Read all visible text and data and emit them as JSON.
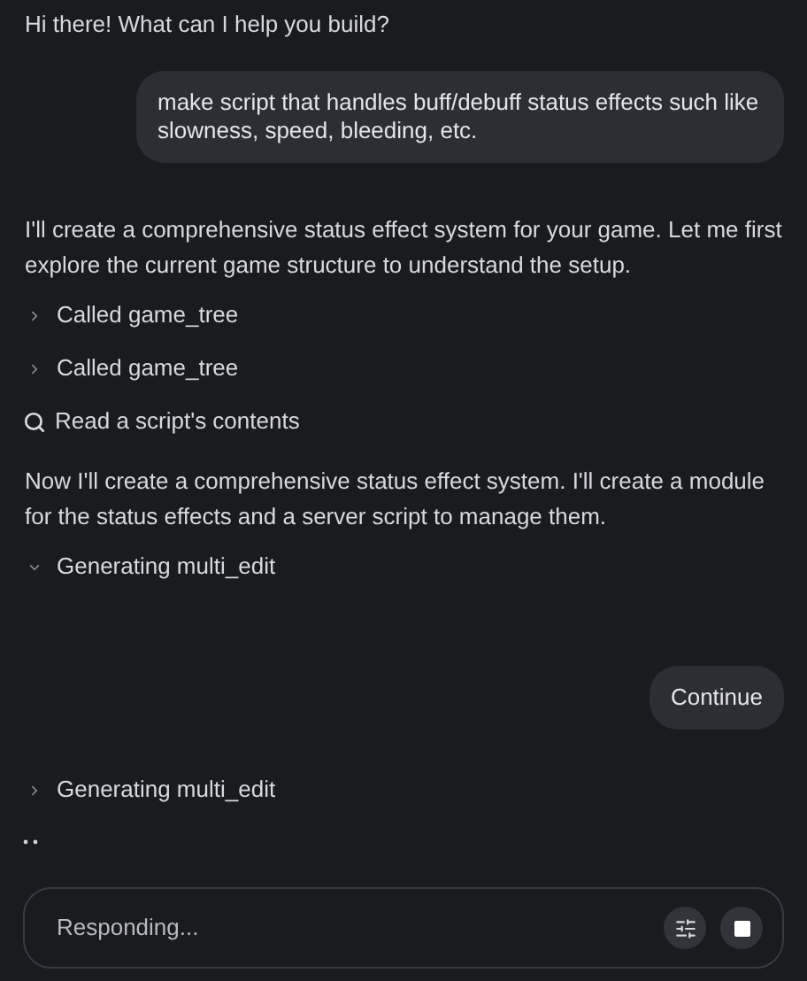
{
  "messages": [
    {
      "kind": "assistant",
      "text": "Hi there! What can I help you build?"
    },
    {
      "kind": "user",
      "text": "make script that handles buff/debuff status effects such like slowness, speed, bleeding, etc."
    },
    {
      "kind": "assistant",
      "text": "I'll create a comprehensive status effect system for your game. Let me first explore the current game structure to understand the setup."
    },
    {
      "kind": "tool",
      "text": "Called game_tree",
      "expanded": false
    },
    {
      "kind": "tool",
      "text": "Called game_tree",
      "expanded": false
    },
    {
      "kind": "search",
      "text": "Read a script's contents"
    },
    {
      "kind": "assistant",
      "text": "Now I'll create a comprehensive status effect system. I'll create a module for the status effects and a server script to manage them."
    },
    {
      "kind": "tool",
      "text": "Generating multi_edit",
      "expanded": true
    },
    {
      "kind": "user",
      "text": "Continue"
    },
    {
      "kind": "tool",
      "text": "Generating multi_edit",
      "expanded": false
    },
    {
      "kind": "typing"
    }
  ],
  "composer": {
    "placeholder": "Responding..."
  }
}
